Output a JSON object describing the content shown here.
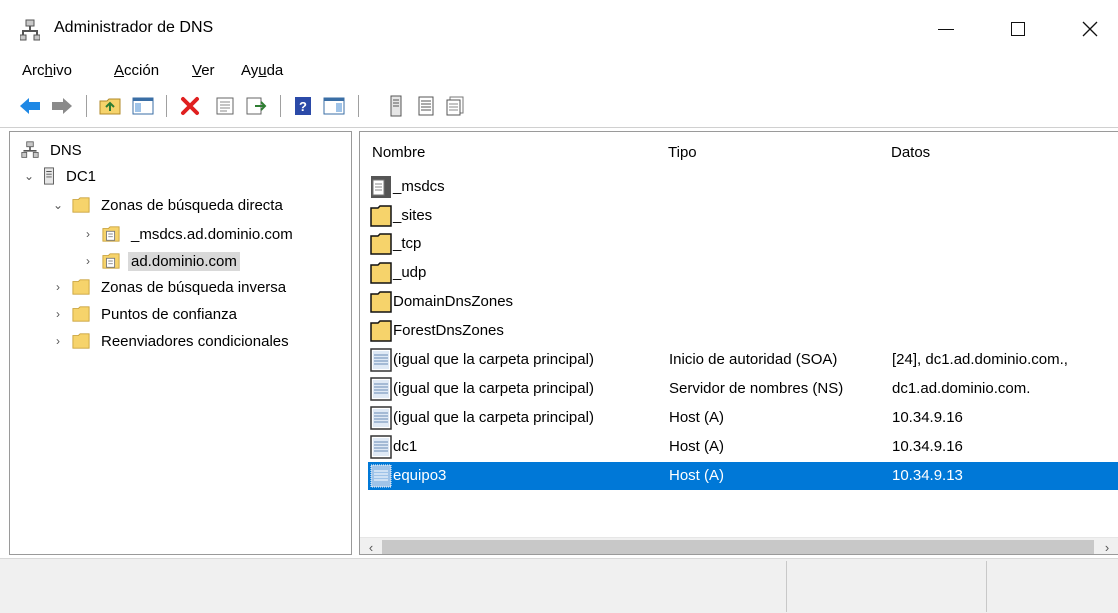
{
  "window": {
    "title": "Administrador de DNS"
  },
  "menu": {
    "archivo": {
      "pre": "Arc",
      "key": "h",
      "post": "ivo"
    },
    "accion": {
      "pre": "",
      "key": "A",
      "post": "cción"
    },
    "ver": {
      "pre": "",
      "key": "V",
      "post": "er"
    },
    "ayuda": {
      "pre": "Ay",
      "key": "u",
      "post": "da"
    }
  },
  "tree": {
    "root": "DNS",
    "server": "DC1",
    "forward_zones": "Zonas de búsqueda directa",
    "zone_msdcs": "_msdcs.ad.dominio.com",
    "zone_ad": "ad.dominio.com",
    "reverse_zones": "Zonas de búsqueda inversa",
    "trust_points": "Puntos de confianza",
    "conditional_forwarders": "Reenviadores condicionales"
  },
  "list": {
    "columns": {
      "name": "Nombre",
      "type": "Tipo",
      "data": "Datos"
    },
    "rows": [
      {
        "name": "_msdcs",
        "type": "",
        "data": "",
        "icon": "zone-folder-icon"
      },
      {
        "name": "_sites",
        "type": "",
        "data": "",
        "icon": "folder-icon"
      },
      {
        "name": "_tcp",
        "type": "",
        "data": "",
        "icon": "folder-icon"
      },
      {
        "name": "_udp",
        "type": "",
        "data": "",
        "icon": "folder-icon"
      },
      {
        "name": "DomainDnsZones",
        "type": "",
        "data": "",
        "icon": "folder-icon"
      },
      {
        "name": "ForestDnsZones",
        "type": "",
        "data": "",
        "icon": "folder-icon"
      },
      {
        "name": "(igual que la carpeta principal)",
        "type": "Inicio de autoridad (SOA)",
        "data": "[24], dc1.ad.dominio.com., ",
        "icon": "record-icon"
      },
      {
        "name": "(igual que la carpeta principal)",
        "type": "Servidor de nombres (NS)",
        "data": "dc1.ad.dominio.com.",
        "icon": "record-icon"
      },
      {
        "name": "(igual que la carpeta principal)",
        "type": "Host (A)",
        "data": "10.34.9.16",
        "icon": "record-icon"
      },
      {
        "name": "dc1",
        "type": "Host (A)",
        "data": "10.34.9.16",
        "icon": "record-icon"
      },
      {
        "name": "equipo3",
        "type": "Host (A)",
        "data": "10.34.9.13",
        "icon": "record-icon",
        "selected": true
      }
    ]
  },
  "colors": {
    "selection": "#0078d7",
    "folder": "#f6d36b",
    "back_arrow": "#1e88e5",
    "delete_x": "#e02020",
    "help": "#2b4aa8"
  }
}
